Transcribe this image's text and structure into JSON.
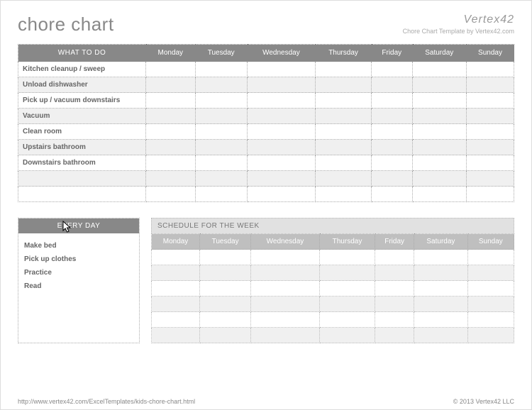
{
  "title": "chore chart",
  "brand": {
    "name": "Vertex42",
    "sub": "Chore Chart Template by Vertex42.com"
  },
  "days": [
    "Monday",
    "Tuesday",
    "Wednesday",
    "Thursday",
    "Friday",
    "Saturday",
    "Sunday"
  ],
  "what_header": "WHAT TO DO",
  "chores": [
    "Kitchen cleanup / sweep",
    "Unload dishwasher",
    "Pick up / vacuum downstairs",
    "Vacuum",
    "Clean room",
    "Upstairs bathroom",
    "Downstairs bathroom",
    "",
    ""
  ],
  "everyday_header": "EVERY DAY",
  "everyday": [
    "Make bed",
    "Pick up clothes",
    "Practice",
    "Read"
  ],
  "schedule_header": "SCHEDULE FOR THE WEEK",
  "footer_url": "http://www.vertex42.com/ExcelTemplates/kids-chore-chart.html",
  "footer_copy": "© 2013 Vertex42 LLC"
}
